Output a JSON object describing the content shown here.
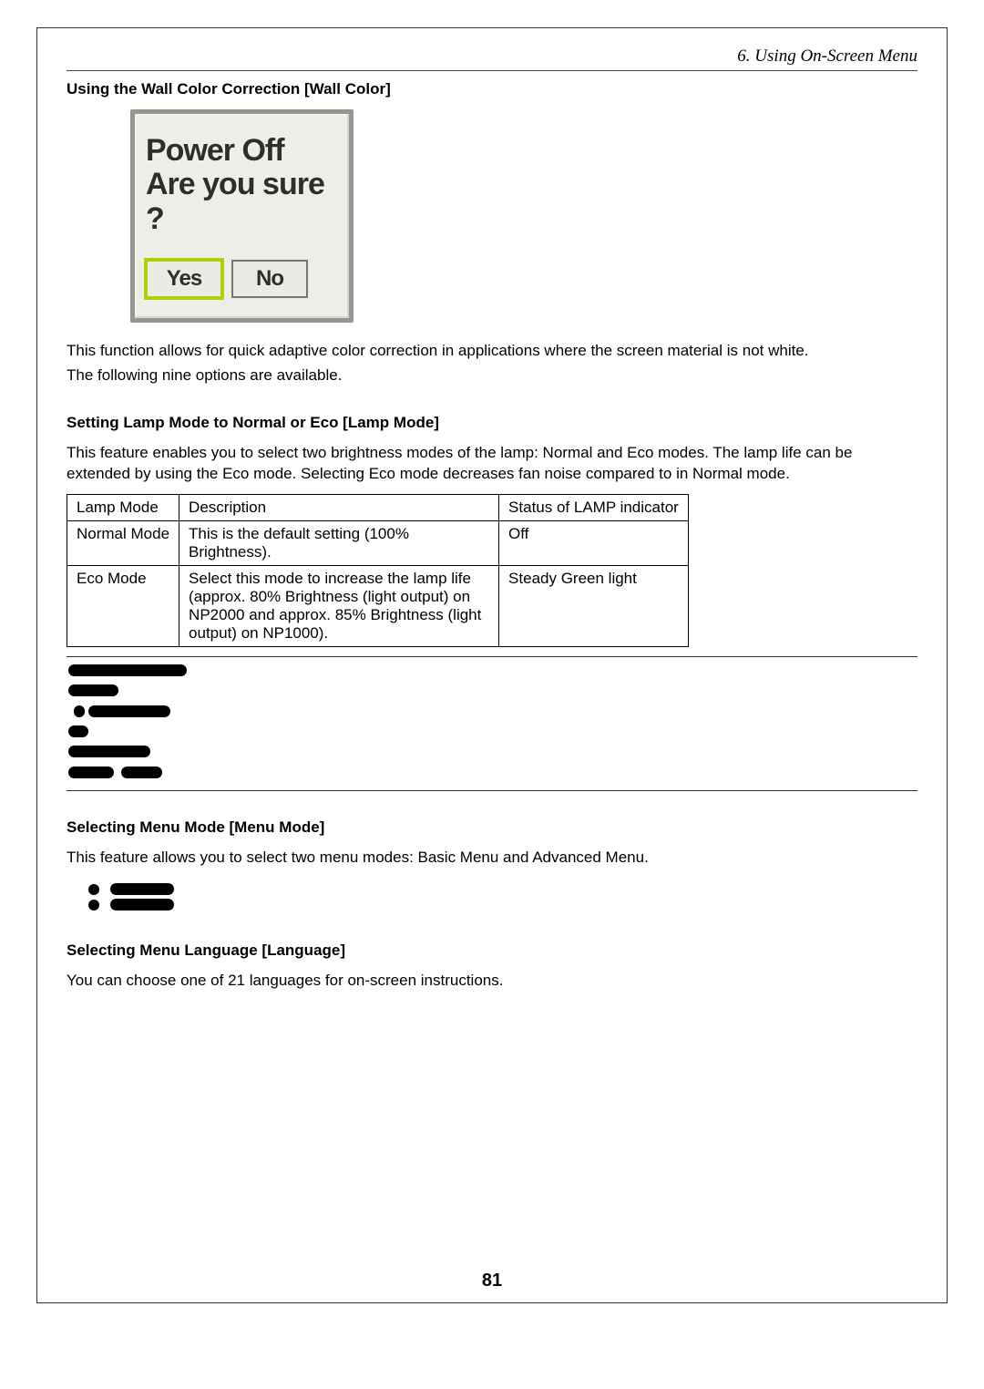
{
  "header": {
    "chapter": "6. Using On-Screen Menu"
  },
  "sections": {
    "wall_color": {
      "title": "Using the Wall Color Correction [Wall Color]",
      "dialog": {
        "line1": "Power Off",
        "line2": "Are you sure ?",
        "yes": "Yes",
        "no": "No"
      },
      "para1": "This function allows for quick adaptive color correction in applications where the screen material is not white.",
      "para2": "The following nine options are available."
    },
    "lamp_mode": {
      "title": "Setting Lamp Mode to Normal or Eco [Lamp Mode]",
      "para": "This feature enables you to select two brightness modes of the lamp: Normal and Eco modes. The lamp life can be extended by using the Eco mode. Selecting Eco mode decreases fan noise compared to in Normal mode.",
      "table": {
        "headers": [
          "Lamp Mode",
          "Description",
          "Status of LAMP indicator"
        ],
        "rows": [
          [
            "Normal Mode",
            "This is the default setting (100% Brightness).",
            "Off"
          ],
          [
            "Eco Mode",
            "Select this mode to increase the lamp life (approx. 80% Brightness (light output) on NP2000 and approx. 85% Brightness (light output) on NP1000).",
            "Steady Green light"
          ]
        ]
      }
    },
    "menu_mode": {
      "title": "Selecting Menu Mode [Menu Mode]",
      "para": "This feature allows you to select two menu modes: Basic Menu and Advanced Menu."
    },
    "language": {
      "title": "Selecting Menu Language [Language]",
      "para": "You can choose one of 21 languages for on-screen instructions."
    }
  },
  "page_number": "81"
}
